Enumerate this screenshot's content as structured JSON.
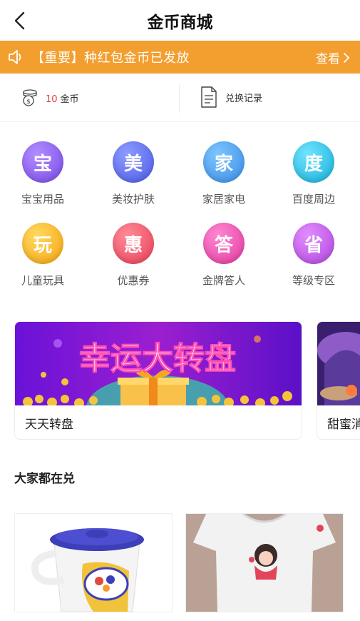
{
  "header": {
    "title": "金币商城"
  },
  "notice": {
    "text": "【重要】种红包金币已发放",
    "more_label": "查看"
  },
  "stats": {
    "coin_count": "10",
    "coin_unit": "金币",
    "records_label": "兑换记录"
  },
  "categories": [
    {
      "glyph": "宝",
      "label": "宝宝用品",
      "color": "#8a5cf0"
    },
    {
      "glyph": "美",
      "label": "美妆护肤",
      "color": "#5f6cf3"
    },
    {
      "glyph": "家",
      "label": "家居家电",
      "color": "#4aa3f2"
    },
    {
      "glyph": "度",
      "label": "百度周边",
      "color": "#2ec4e6"
    },
    {
      "glyph": "玩",
      "label": "儿童玩具",
      "color": "#f9b51f"
    },
    {
      "glyph": "惠",
      "label": "优惠券",
      "color": "#f25a6e"
    },
    {
      "glyph": "答",
      "label": "金牌答人",
      "color": "#ef4fb0"
    },
    {
      "glyph": "省",
      "label": "等级专区",
      "color": "#c55be6"
    }
  ],
  "cards": [
    {
      "banner_text": "幸运大转盘",
      "label": "天天转盘"
    },
    {
      "label": "甜蜜消"
    }
  ],
  "section": {
    "title": "大家都在兑"
  }
}
